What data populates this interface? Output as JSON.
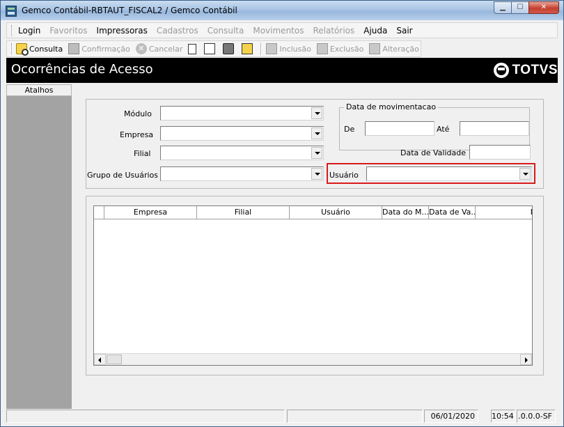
{
  "window": {
    "title": "Gemco Contábil-RBTAUT_FISCAL2 / Gemco Contábil",
    "minimize_glyph": "▁",
    "maximize_glyph": "☐",
    "close_glyph": "✕"
  },
  "menu": {
    "items": [
      {
        "label": "Login",
        "enabled": true
      },
      {
        "label": "Favoritos",
        "enabled": false
      },
      {
        "label": "Impressoras",
        "enabled": true
      },
      {
        "label": "Cadastros",
        "enabled": false
      },
      {
        "label": "Consulta",
        "enabled": false
      },
      {
        "label": "Movimentos",
        "enabled": false
      },
      {
        "label": "Relatórios",
        "enabled": false
      },
      {
        "label": "Ajuda",
        "enabled": true
      },
      {
        "label": "Sair",
        "enabled": true
      }
    ]
  },
  "toolbar": {
    "consulta": "Consulta",
    "confirmacao": "Confirmação",
    "cancelar": "Cancelar",
    "inclusao": "Inclusão",
    "exclusao": "Exclusão",
    "alteracao": "Alteração",
    "cancel_glyph": "✕"
  },
  "header": {
    "title": "Ocorrências de Acesso",
    "logo_text": "TOTVS"
  },
  "sidebar": {
    "tab_label": "Atalhos"
  },
  "form": {
    "modulo_label": "Módulo",
    "modulo_value": "",
    "empresa_label": "Empresa",
    "empresa_value": "",
    "filial_label": "Filial",
    "filial_value": "",
    "grupo_label": "Grupo de Usuários",
    "grupo_value": "",
    "usuario_label": "Usuário",
    "usuario_value": "",
    "data_group_title": "Data de movimentacao",
    "de_label": "De",
    "de_value": "",
    "ate_label": "Até",
    "ate_value": "",
    "validade_label": "Data de Validade",
    "validade_value": ""
  },
  "grid": {
    "columns": [
      "Empresa",
      "Filial",
      "Usuário",
      "Data do M...",
      "Data de Va...",
      "Mó"
    ],
    "rows": []
  },
  "status": {
    "date": "06/01/2020",
    "time": "10:54",
    "version": ".0.0.0-SF"
  }
}
